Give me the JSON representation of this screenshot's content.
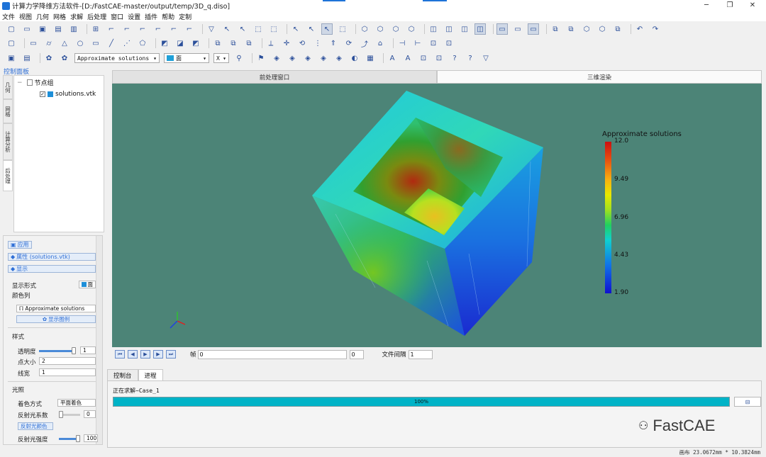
{
  "window": {
    "title": "计算力学降维方法软件-[D:/FastCAE-master/output/temp/3D_q.diso]",
    "minimize": "─",
    "maximize": "❐",
    "close": "✕"
  },
  "menu": [
    "文件",
    "视图",
    "几何",
    "网格",
    "求解",
    "后处理",
    "窗口",
    "设置",
    "插件",
    "帮助",
    "定制"
  ],
  "toolbar3": {
    "color_combo": "Approximate solutions",
    "face_combo": "面",
    "axis_combo": "X"
  },
  "control_panel": {
    "title": "控制面板",
    "side_tabs": [
      "几何",
      "网格",
      "计算分析",
      "后处理"
    ],
    "tree": {
      "root": "节点组",
      "child": "solutions.vtk"
    }
  },
  "properties": {
    "apply": "应用",
    "attr": "属性 (solutions.vtk)",
    "display": "显示",
    "display_mode_label": "显示形式",
    "display_mode_value": "面",
    "color_label": "颜色列",
    "color_value": "Approximate solutions",
    "show_legend": "显示图例",
    "style_header": "样式",
    "opacity_label": "透明度",
    "opacity_value": "1",
    "opacity_level": 1.0,
    "point_size_label": "点大小",
    "point_size_value": "2",
    "line_width_label": "线宽",
    "line_width_value": "1",
    "lighting_header": "光照",
    "shading_label": "着色方式",
    "shading_value": "平面着色",
    "reflect_coef_label": "反射光系数",
    "reflect_coef_value": "0",
    "reflect_color": "反射光颜色",
    "reflect_intensity_label": "反射光强度",
    "reflect_intensity_value": "100"
  },
  "view_tabs": [
    "前处理窗口",
    "三维渲染"
  ],
  "viewport": {
    "legend_title": "Approximate solutions",
    "legend_ticks": [
      "12.0",
      "9.49",
      "6.96",
      "4.43",
      "1.90"
    ],
    "bg_color": "#4c8477"
  },
  "playbar": {
    "frame_label": "帧",
    "frame_value": "0",
    "spin_value": "0",
    "interval_label": "文件间隔",
    "interval_value": "1"
  },
  "bottom": {
    "tabs": [
      "控制台",
      "进程"
    ],
    "status_text": "正在求解~Case_1",
    "progress_text": "100%",
    "progress": 1.0
  },
  "statusbar": {
    "text": "画布 23.0672mm * 10.3824mm"
  },
  "watermark": "FastCAE"
}
